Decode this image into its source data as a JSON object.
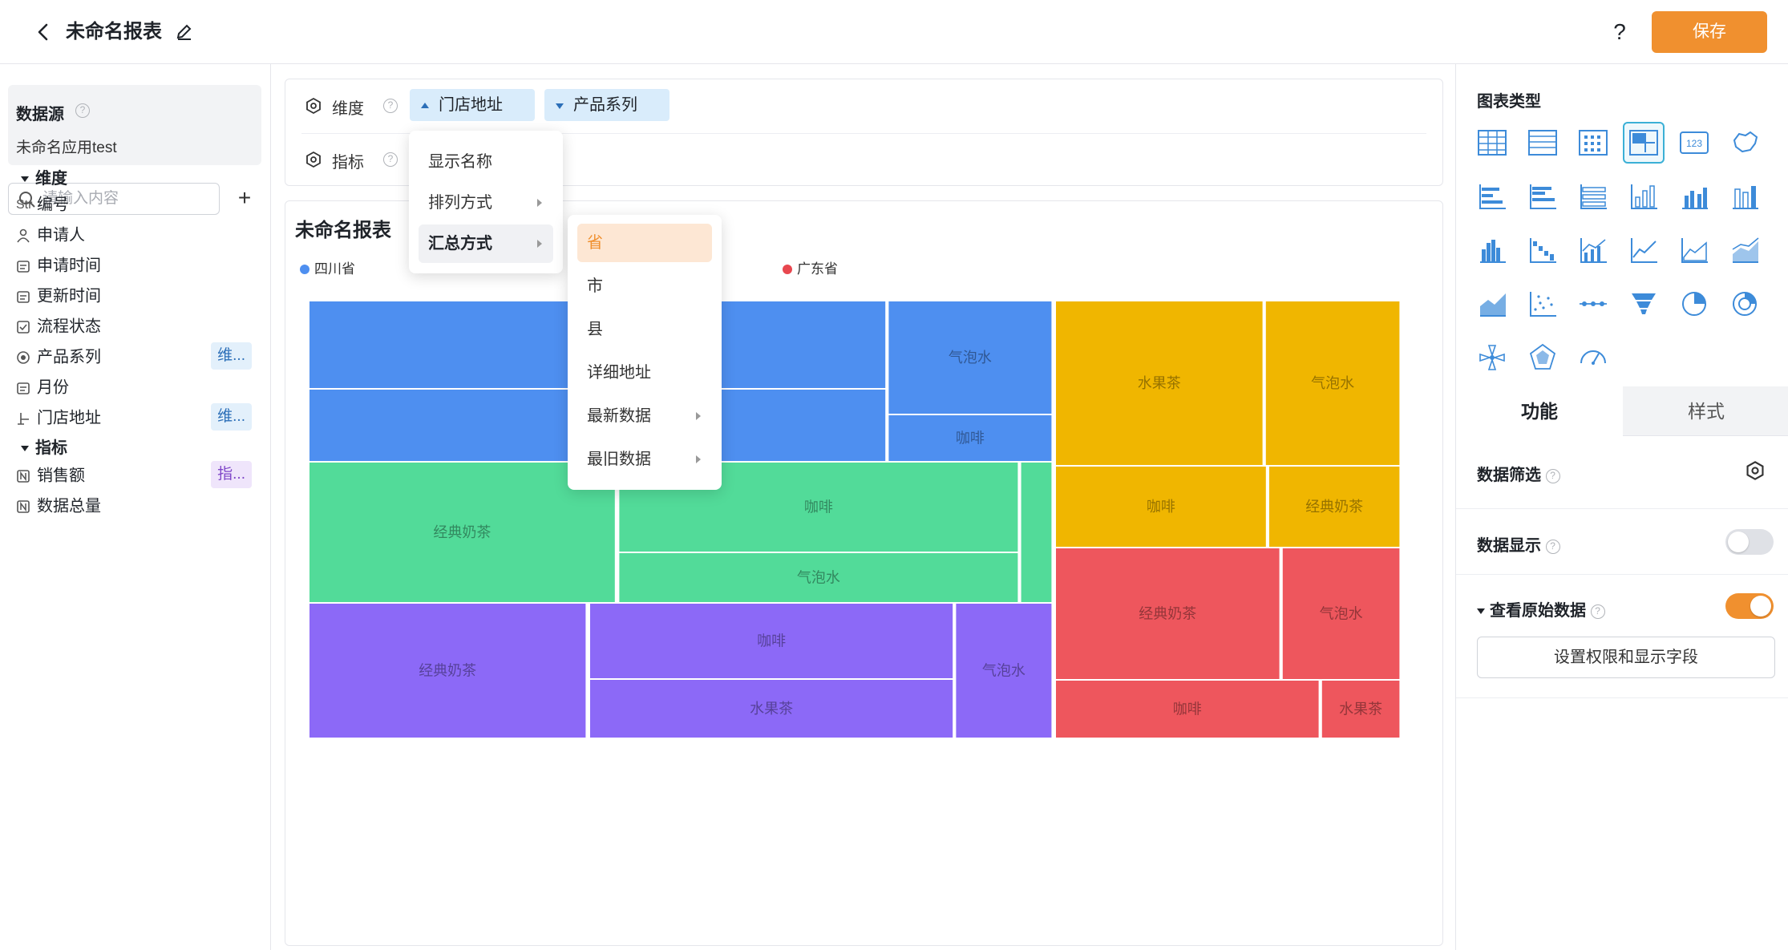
{
  "header": {
    "title": "未命名报表",
    "help": "?",
    "save_label": "保存"
  },
  "left": {
    "datasource_title": "数据源",
    "datasource_name": "未命名应用test",
    "search_placeholder": "请输入内容",
    "dim_section": "维度",
    "dimensions": [
      {
        "icon": "str-type-icon",
        "icon_text": "Str",
        "label": "编号",
        "tag": ""
      },
      {
        "icon": "person-icon",
        "label": "申请人",
        "tag": ""
      },
      {
        "icon": "calendar-icon",
        "label": "申请时间",
        "tag": ""
      },
      {
        "icon": "calendar-icon",
        "label": "更新时间",
        "tag": ""
      },
      {
        "icon": "checkbox-icon",
        "label": "流程状态",
        "tag": ""
      },
      {
        "icon": "radio-icon",
        "label": "产品系列",
        "tag": "维..."
      },
      {
        "icon": "calendar-icon",
        "label": "月份",
        "tag": ""
      },
      {
        "icon": "location-icon",
        "label": "门店地址",
        "tag": "维..."
      }
    ],
    "mea_section": "指标",
    "measures": [
      {
        "icon": "number-icon",
        "label": "销售额",
        "tag": "指..."
      },
      {
        "icon": "number-icon",
        "label": "数据总量",
        "tag": ""
      }
    ]
  },
  "config": {
    "dim_label": "维度",
    "mea_label": "指标",
    "chips": [
      "门店地址",
      "产品系列"
    ]
  },
  "menu1": {
    "items": [
      "显示名称",
      "排列方式",
      "汇总方式"
    ]
  },
  "menu2": {
    "items": [
      "省",
      "市",
      "县",
      "详细地址",
      "最新数据",
      "最旧数据"
    ]
  },
  "chart": {
    "title": "未命名报表"
  },
  "chart_data": {
    "type": "treemap",
    "title": "未命名报表",
    "legend": [
      {
        "name": "四川省",
        "color": "#4e8ff0"
      },
      {
        "name": "广东省",
        "color": "#e8474f"
      }
    ],
    "series": [
      {
        "name": "四川省",
        "color": "#4e8ff0"
      },
      {
        "name": "",
        "color": "#52db99"
      },
      {
        "name": "",
        "color": "#8c69f7"
      },
      {
        "name": "",
        "color": "#f0b600"
      },
      {
        "name": "广东省",
        "color": "#ee565d"
      }
    ],
    "labels": [
      "经典奶茶",
      "咖啡",
      "气泡水",
      "水果茶"
    ]
  },
  "right": {
    "chart_type_title": "图表类型",
    "tab_function": "功能",
    "tab_style": "样式",
    "data_filter": "数据筛选",
    "data_display": "数据显示",
    "view_raw": "查看原始数据",
    "perm_button": "设置权限和显示字段",
    "data_display_on": false,
    "view_raw_on": true
  }
}
